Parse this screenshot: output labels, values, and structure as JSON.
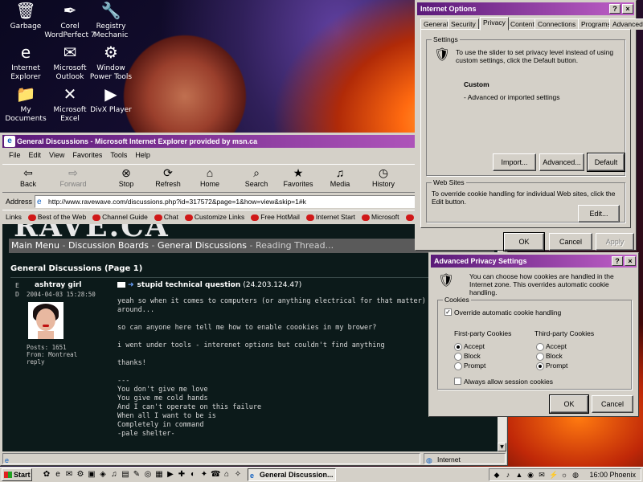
{
  "desktop": {
    "icons": [
      {
        "label": "Garbage",
        "icon": "trash-icon",
        "glyph": "🗑"
      },
      {
        "label": "Corel WordPerfect 7",
        "icon": "wordperfect-icon",
        "glyph": "✒"
      },
      {
        "label": "Registry Mechanic",
        "icon": "registry-mechanic-icon",
        "glyph": "🔧"
      },
      {
        "label": "Internet Explorer",
        "icon": "ie-icon",
        "glyph": "e"
      },
      {
        "label": "Microsoft Outlook",
        "icon": "outlook-icon",
        "glyph": "✉"
      },
      {
        "label": "Window Power Tools",
        "icon": "power-tools-icon",
        "glyph": "⚙"
      },
      {
        "label": "My Documents",
        "icon": "folder-icon",
        "glyph": "📁"
      },
      {
        "label": "Microsoft Excel",
        "icon": "excel-icon",
        "glyph": "✕"
      },
      {
        "label": "DivX Player",
        "icon": "divx-icon",
        "glyph": "▶"
      }
    ]
  },
  "ie": {
    "title": "General Discussions - Microsoft Internet Explorer provided by msn.ca",
    "menu": [
      "File",
      "Edit",
      "View",
      "Favorites",
      "Tools",
      "Help"
    ],
    "toolbar": [
      {
        "label": "Back",
        "icon": "back-arrow-icon",
        "glyph": "⇦"
      },
      {
        "label": "Forward",
        "icon": "forward-arrow-icon",
        "glyph": "⇨"
      },
      {
        "label": "Stop",
        "icon": "stop-icon",
        "glyph": "⊗"
      },
      {
        "label": "Refresh",
        "icon": "refresh-icon",
        "glyph": "⟳"
      },
      {
        "label": "Home",
        "icon": "home-icon",
        "glyph": "⌂"
      },
      {
        "label": "Search",
        "icon": "search-icon",
        "glyph": "⌕"
      },
      {
        "label": "Favorites",
        "icon": "favorites-icon",
        "glyph": "★"
      },
      {
        "label": "Media",
        "icon": "media-icon",
        "glyph": "♫"
      },
      {
        "label": "History",
        "icon": "history-icon",
        "glyph": "◷"
      }
    ],
    "address_label": "Address",
    "address_url": "http://www.ravewave.com/discussions.php?id=317572&page=1&how=view&skip=1#k",
    "links_label": "Links",
    "links": [
      "Best of the Web",
      "Channel Guide",
      "Chat",
      "Customize Links",
      "Free HotMail",
      "Internet Start",
      "Microsoft",
      "msn.ca"
    ],
    "status_text": "",
    "status_zone": "Internet"
  },
  "page": {
    "logo": "RAVE.CA",
    "nav": [
      "Main Menu",
      "Discussion Boards",
      "General Discussions",
      "Reading Thread..."
    ],
    "nav_sep": " - ",
    "section_title": "General Discussions (Page 1)",
    "post": {
      "ed_label": "E D",
      "username": "ashtray girl",
      "date": "2004-04-03 15:28:50",
      "posts": "Posts: 1651",
      "from": "From: Montreal",
      "reply": "reply",
      "subject": "stupid technical question",
      "ip": "(24.203.124.47)",
      "body": "yeah so when it comes to computers (or anything electrical for that matter) I am th\naround...\n\nso can anyone here tell me how to enable coookies in my brower?\n\ni went under tools - interenet options but couldn't find anything\n\nthanks!\n\n---\nYou don't give me love\nYou give me cold hands\nAnd I can't operate on this failure\nWhen all I want to be is\nCompletely in command\n-pale shelter-"
    }
  },
  "internet_options": {
    "title": "Internet Options",
    "tabs": [
      "General",
      "Security",
      "Privacy",
      "Content",
      "Connections",
      "Programs",
      "Advanced"
    ],
    "active_tab": "Privacy",
    "settings_label": "Settings",
    "settings_text": "To use the slider to set privacy level instead of using custom settings, click the Default button.",
    "level_name": "Custom",
    "level_desc": "- Advanced or imported settings",
    "buttons": {
      "import": "Import...",
      "advanced": "Advanced...",
      "default": "Default"
    },
    "websites_label": "Web Sites",
    "websites_text": "To override cookie handling for individual Web sites, click the Edit button.",
    "edit": "Edit...",
    "ok": "OK",
    "cancel": "Cancel",
    "apply": "Apply"
  },
  "advanced_privacy": {
    "title": "Advanced Privacy Settings",
    "intro": "You can choose how cookies are handled in the Internet zone. This overrides automatic cookie handling.",
    "cookies_label": "Cookies",
    "override_label": "Override automatic cookie handling",
    "override_checked": true,
    "first_party_label": "First-party Cookies",
    "third_party_label": "Third-party Cookies",
    "options": [
      "Accept",
      "Block",
      "Prompt"
    ],
    "first_party_selected": "Accept",
    "third_party_selected": "Prompt",
    "session_label": "Always allow session cookies",
    "session_checked": false,
    "ok": "OK",
    "cancel": "Cancel"
  },
  "taskbar": {
    "start": "Start",
    "task_item": "General Discussion...",
    "clock": "16:00 Phoenix"
  }
}
